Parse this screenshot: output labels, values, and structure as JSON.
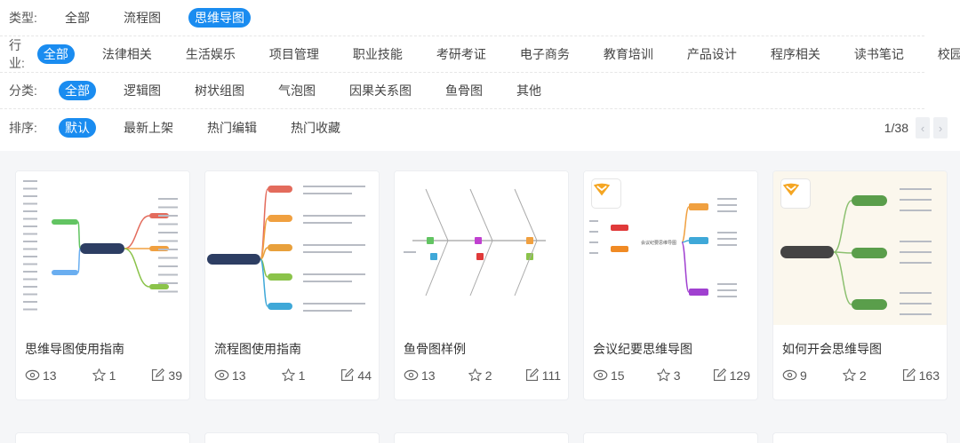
{
  "filters": {
    "type": {
      "label": "类型:",
      "options": [
        "全部",
        "流程图",
        "思维导图"
      ],
      "active": "思维导图"
    },
    "industry": {
      "label": "行业:",
      "options": [
        "全部",
        "法律相关",
        "生活娱乐",
        "项目管理",
        "职业技能",
        "考研考证",
        "电子商务",
        "教育培训",
        "产品设计",
        "程序相关",
        "读书笔记",
        "校园教育"
      ],
      "active": "全部"
    },
    "category": {
      "label": "分类:",
      "options": [
        "全部",
        "逻辑图",
        "树状组图",
        "气泡图",
        "因果关系图",
        "鱼骨图",
        "其他"
      ],
      "active": "全部"
    },
    "sort": {
      "label": "排序:",
      "options": [
        "默认",
        "最新上架",
        "热门编辑",
        "热门收藏"
      ],
      "active": "默认"
    }
  },
  "pager": {
    "text": "1/38",
    "prev_icon": "chevron-left-icon",
    "next_icon": "chevron-right-icon"
  },
  "colors": {
    "accent": "#1a8cf0",
    "badge": "#f5a623"
  },
  "cards": [
    {
      "title": "思维导图使用指南",
      "views": "13",
      "stars": "1",
      "edits": "39",
      "thumb": "mindmap-guide"
    },
    {
      "title": "流程图使用指南",
      "views": "13",
      "stars": "1",
      "edits": "44",
      "thumb": "flow-guide"
    },
    {
      "title": "鱼骨图样例",
      "views": "13",
      "stars": "2",
      "edits": "111",
      "thumb": "fishbone"
    },
    {
      "title": "会议纪要思维导图",
      "views": "15",
      "stars": "3",
      "edits": "129",
      "thumb": "meeting",
      "badge": true
    },
    {
      "title": "如何开会思维导图",
      "views": "9",
      "stars": "2",
      "edits": "163",
      "thumb": "how-meeting",
      "badge": true
    }
  ]
}
